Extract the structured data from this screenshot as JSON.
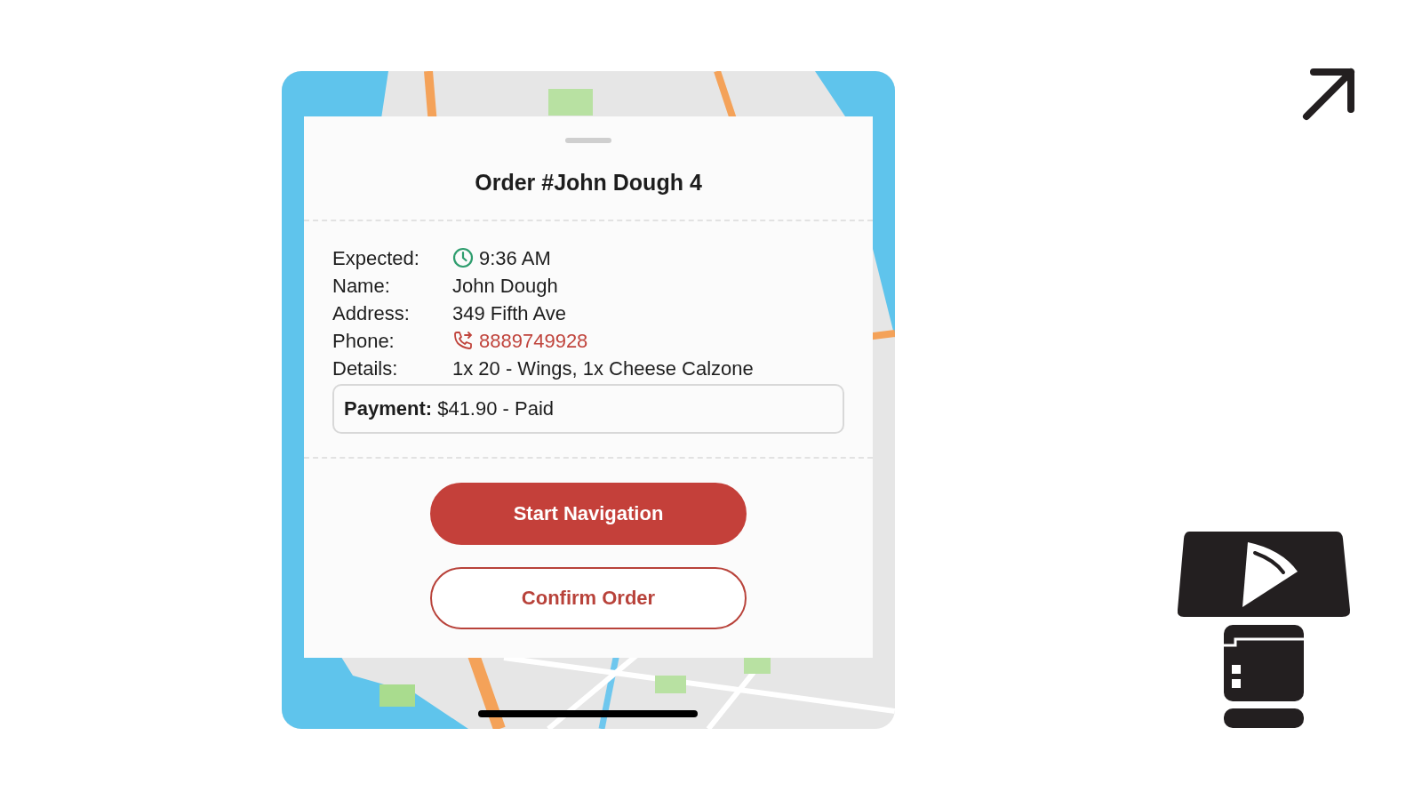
{
  "order_sheet": {
    "title": "Order #John Dough 4",
    "fields": [
      {
        "kind": "time",
        "label": "Expected:",
        "value": "9:36 AM"
      },
      {
        "kind": "text",
        "label": "Name:",
        "value": "John Dough"
      },
      {
        "kind": "text",
        "label": "Address:",
        "value": "349 Fifth Ave"
      },
      {
        "kind": "phone",
        "label": "Phone:",
        "value": "8889749928"
      },
      {
        "kind": "text",
        "label": "Details:",
        "value": "1x 20 - Wings, 1x Cheese Calzone"
      }
    ],
    "payment": {
      "label": "Payment:",
      "value": "$41.90 - Paid"
    },
    "buttons": [
      {
        "kind": "primary",
        "label": "Start Navigation"
      },
      {
        "kind": "outline",
        "label": "Confirm Order"
      }
    ]
  }
}
